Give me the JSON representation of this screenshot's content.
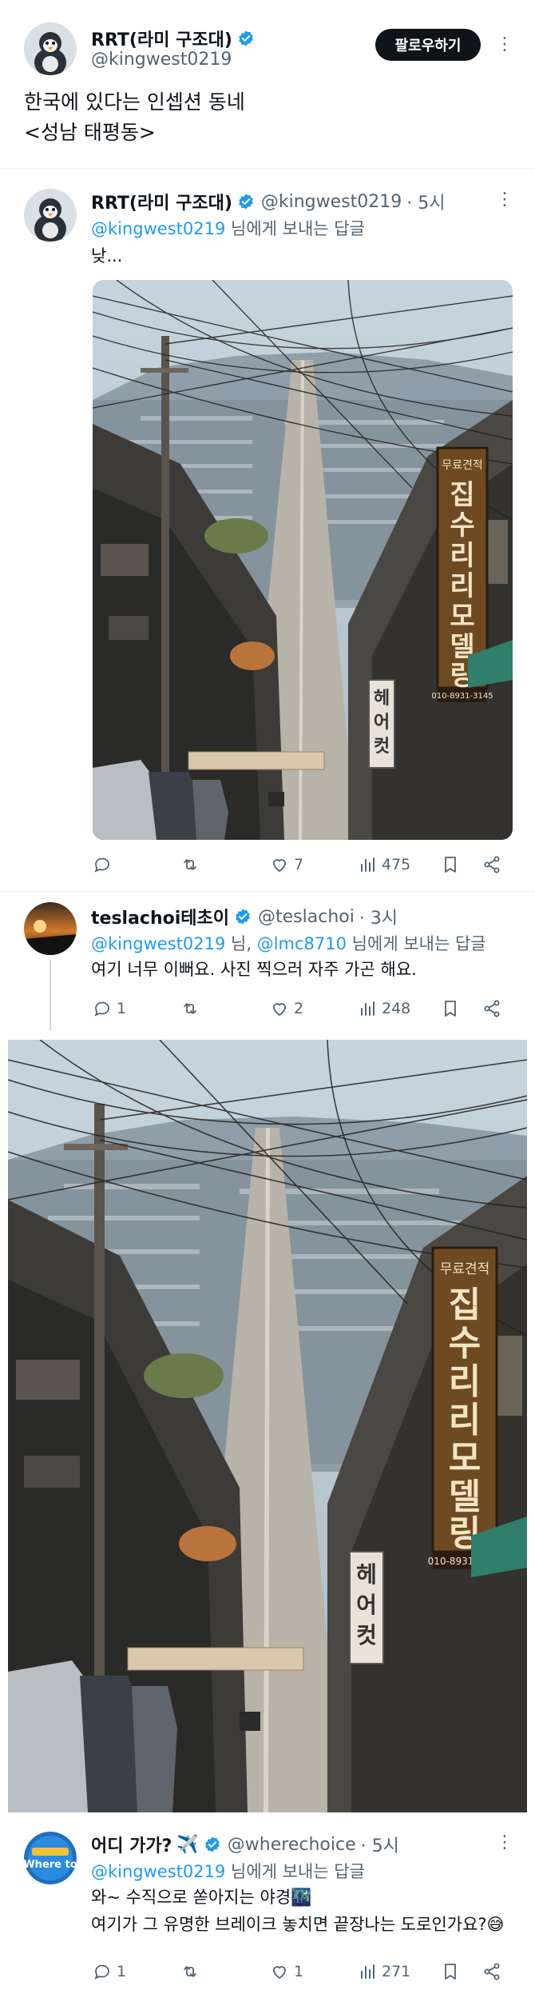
{
  "post": {
    "author_name": "RRT(라미 구조대)",
    "author_handle": "@kingwest0219",
    "follow_label": "팔로우하기",
    "line1": "한국에 있다는 인셉션 동네",
    "line2": "<성남 태평동>"
  },
  "reply1": {
    "author_name": "RRT(라미 구조대)",
    "author_handle": "@kingwest0219",
    "time": "· 5시",
    "reply_to_user": "@kingwest0219",
    "reply_to_suffix": " 님에게 보내는 답글",
    "text": "낮...",
    "photo_sign1": "집수리리모델링",
    "photo_sign2": "헤어컷",
    "photo_sign_top": "무료견적",
    "photo_phone": "010-8931-3145",
    "replies": "",
    "reposts": "",
    "likes": "7",
    "views": "475"
  },
  "reply2": {
    "author_name": "teslachoi테초이",
    "author_handle": "@teslachoi",
    "time": "· 3시",
    "reply_to_user1": "@kingwest0219",
    "reply_to_mid": " 님, ",
    "reply_to_user2": "@lmc8710",
    "reply_to_suffix": " 님에게 보내는 답글",
    "text": "여기 너무 이뻐요. 사진 찍으러 자주 가곤 해요.",
    "replies": "1",
    "reposts": "",
    "likes": "2",
    "views": "248"
  },
  "reply3": {
    "author_name": "어디 가가?",
    "author_emoji": "✈️",
    "author_handle": "@wherechoice",
    "time": "· 5시",
    "avatar_text": "Where to",
    "reply_to_user": "@kingwest0219",
    "reply_to_suffix": " 님에게 보내는 답글",
    "text_line1": "와~ 수직으로 쏟아지는 야경🌃",
    "text_line2": "여기가 그 유명한 브레이크 놓치면 끝장나는 도로인가요?😅",
    "replies": "1",
    "reposts": "",
    "likes": "1",
    "views": "271"
  },
  "colors": {
    "accent": "#1d9bf0",
    "text": "#0f1419",
    "muted": "#536471"
  }
}
